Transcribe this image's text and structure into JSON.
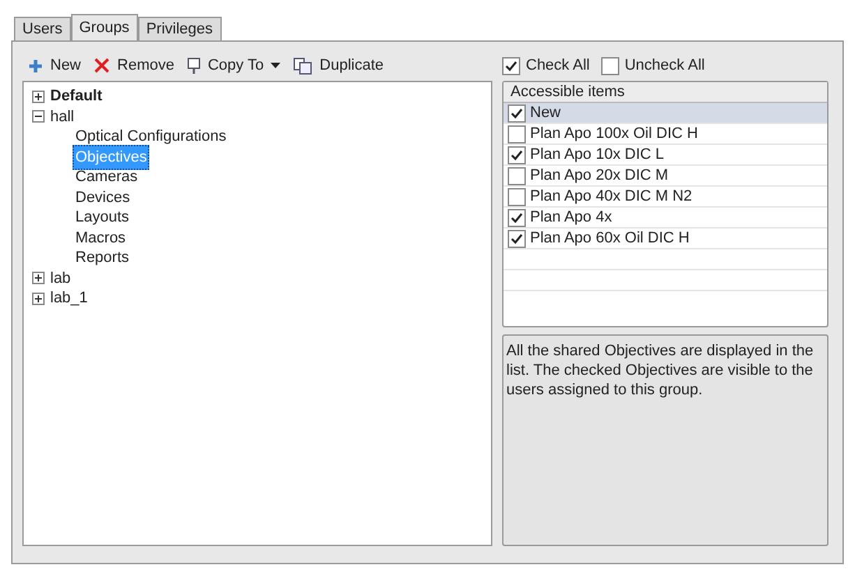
{
  "tabs": [
    {
      "label": "Users",
      "selected": false
    },
    {
      "label": "Groups",
      "selected": true
    },
    {
      "label": "Privileges",
      "selected": false
    }
  ],
  "toolbar": [
    {
      "kind": "new",
      "label": "New"
    },
    {
      "kind": "remove",
      "label": "Remove"
    },
    {
      "kind": "copy",
      "label": "Copy To"
    },
    {
      "kind": "duplicate",
      "label": "Duplicate"
    }
  ],
  "tree": [
    {
      "label": "Default",
      "bold": true,
      "expanded": false
    },
    {
      "label": "hall",
      "bold": false,
      "expanded": true,
      "children": [
        {
          "label": "Optical Configurations",
          "selected": false
        },
        {
          "label": "Objectives",
          "selected": true
        },
        {
          "label": "Cameras",
          "selected": false
        },
        {
          "label": "Devices",
          "selected": false
        },
        {
          "label": "Layouts",
          "selected": false
        },
        {
          "label": "Macros",
          "selected": false
        },
        {
          "label": "Reports",
          "selected": false
        }
      ]
    },
    {
      "label": "lab",
      "bold": false,
      "expanded": false
    },
    {
      "label": "lab_1",
      "bold": false,
      "expanded": false
    }
  ],
  "check_all": {
    "label": "Check All",
    "checked": true
  },
  "uncheck_all": {
    "label": "Uncheck All",
    "checked": false
  },
  "list": {
    "header": "Accessible items",
    "items": [
      {
        "label": "New",
        "checked": true,
        "selected": true
      },
      {
        "label": "Plan Apo 100x Oil DIC H",
        "checked": false,
        "selected": false
      },
      {
        "label": "Plan Apo 10x DIC L",
        "checked": true,
        "selected": false
      },
      {
        "label": "Plan Apo 20x DIC M",
        "checked": false,
        "selected": false
      },
      {
        "label": "Plan Apo 40x DIC M N2",
        "checked": false,
        "selected": false
      },
      {
        "label": "Plan Apo 4x",
        "checked": true,
        "selected": false
      },
      {
        "label": "Plan Apo 60x Oil DIC H",
        "checked": true,
        "selected": false
      }
    ]
  },
  "description": "All the shared Objectives are displayed in the list. The checked Objectives are visible to the users assigned to this group."
}
